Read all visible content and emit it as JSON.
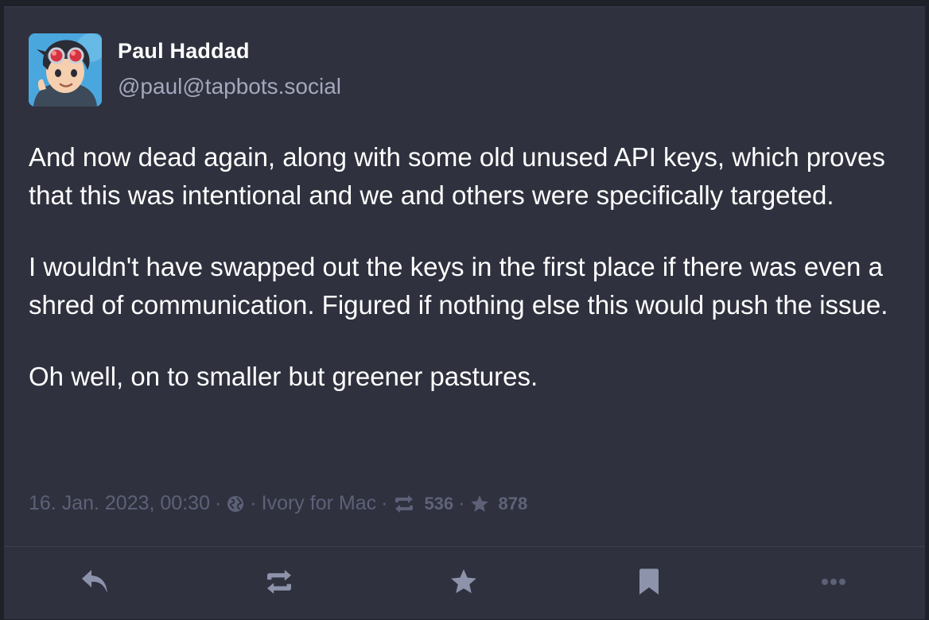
{
  "post": {
    "author_name": "Paul Haddad",
    "author_handle": "@paul@tapbots.social",
    "paragraphs": [
      "And now dead again, along with some old unused API keys, which proves that this was intentional and we and others were specifically targeted.",
      "I wouldn't have swapped out the keys in the first place if there was even a shred of communication. Figured if nothing else this would push the issue.",
      "Oh well, on to smaller but greener pastures."
    ],
    "timestamp": "16. Jan. 2023, 00:30",
    "separator": "·",
    "visibility_icon": "globe-icon",
    "client": "Ivory for Mac",
    "boost_count": "536",
    "favourite_count": "878"
  },
  "colors": {
    "background": "#2f313e",
    "text": "#ffffff",
    "handle": "#a3a8bd",
    "meta": "#5d6178",
    "action_icon": "#8d93ab"
  },
  "actions": [
    "reply-icon",
    "boost-icon",
    "star-icon",
    "bookmark-icon",
    "more-icon"
  ]
}
